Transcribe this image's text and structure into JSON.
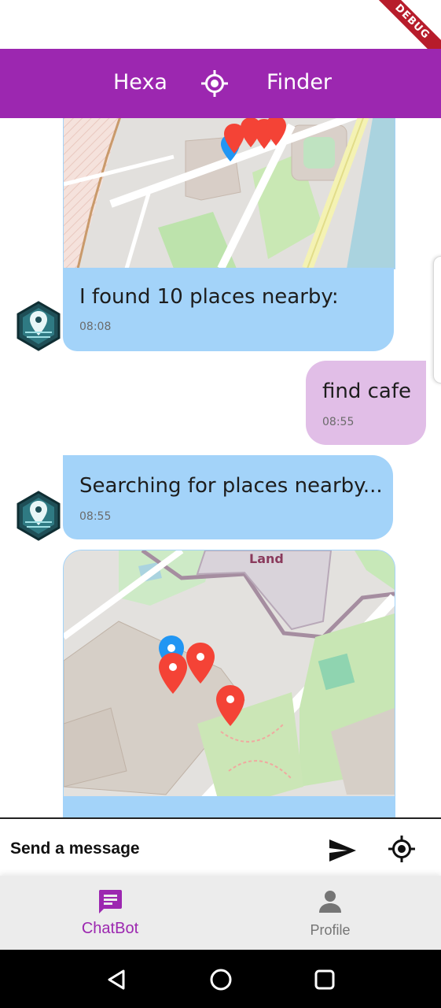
{
  "debug_label": "DEBUG",
  "app_bar": {
    "title_left": "Hexa",
    "title_right": "Finder",
    "icon": "gps-fixed-icon"
  },
  "messages": [
    {
      "id": "m1",
      "sender": "bot",
      "has_map": true,
      "text": "I found 10 places nearby:",
      "time": "08:08"
    },
    {
      "id": "m2",
      "sender": "user",
      "text": "find cafe",
      "time": "08:55"
    },
    {
      "id": "m3",
      "sender": "bot",
      "text": "Searching for places nearby...",
      "time": "08:55"
    },
    {
      "id": "m4",
      "sender": "bot",
      "has_map": true,
      "map_label": "Land"
    }
  ],
  "input": {
    "placeholder": "Send a message",
    "send_icon": "send-icon",
    "location_icon": "gps-fixed-icon"
  },
  "bottom_nav": {
    "items": [
      {
        "label": "ChatBot",
        "icon": "chat-icon",
        "active": true
      },
      {
        "label": "Profile",
        "icon": "person-icon",
        "active": false
      }
    ]
  },
  "colors": {
    "primary": "#9c27b0",
    "bot_bubble": "#a3d3f9",
    "user_bubble": "#e1bee7",
    "marker_red": "#f44336",
    "marker_blue": "#2196f3"
  }
}
